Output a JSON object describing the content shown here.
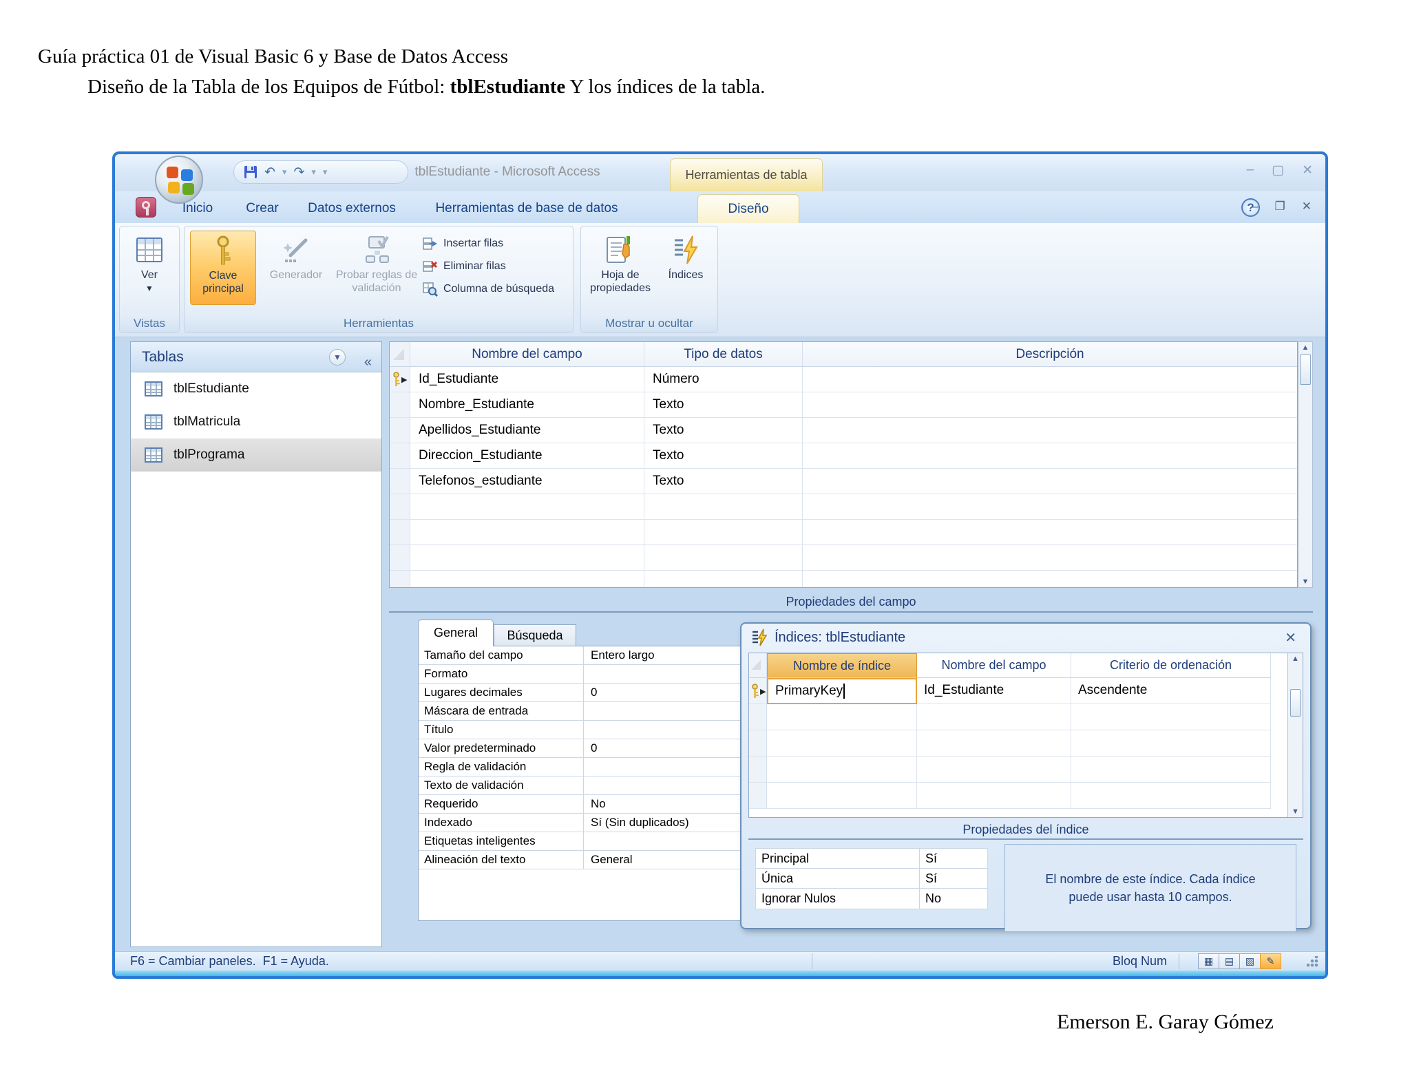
{
  "document": {
    "title": "Guía práctica 01 de Visual Basic 6 y Base de Datos Access",
    "subtitle_prefix": "Diseño de la Tabla de los Equipos de Fútbol: ",
    "subtitle_bold": "tblEstudiante",
    "subtitle_suffix": " Y los índices de la tabla.",
    "author": "Emerson E. Garay Gómez"
  },
  "window": {
    "title": "tblEstudiante - Microsoft Access",
    "contextual_tab_group": "Herramientas de tabla",
    "tabs": [
      "Inicio",
      "Crear",
      "Datos externos",
      "Herramientas de base de datos"
    ],
    "active_tab": "Diseño"
  },
  "ribbon": {
    "vistas": {
      "button": "Ver",
      "label": "Vistas"
    },
    "herramientas": {
      "label": "Herramientas",
      "clave": "Clave principal",
      "generador": "Generador",
      "probar": "Probar reglas de validación",
      "insertar": "Insertar filas",
      "eliminar": "Eliminar filas",
      "columna": "Columna de búsqueda"
    },
    "mostrar": {
      "label": "Mostrar u ocultar",
      "hoja": "Hoja de propiedades",
      "indices": "Índices"
    }
  },
  "nav_pane": {
    "header": "Tablas",
    "items": [
      {
        "label": "tblEstudiante",
        "selected": false
      },
      {
        "label": "tblMatricula",
        "selected": false
      },
      {
        "label": "tblPrograma",
        "selected": true
      }
    ]
  },
  "design_grid": {
    "columns": [
      "Nombre del campo",
      "Tipo de datos",
      "Descripción"
    ],
    "rows": [
      {
        "field": "Id_Estudiante",
        "type": "Número",
        "primary_key": true
      },
      {
        "field": "Nombre_Estudiante",
        "type": "Texto",
        "primary_key": false
      },
      {
        "field": "Apellidos_Estudiante",
        "type": "Texto",
        "primary_key": false
      },
      {
        "field": "Direccion_Estudiante",
        "type": "Texto",
        "primary_key": false
      },
      {
        "field": "Telefonos_estudiante",
        "type": "Texto",
        "primary_key": false
      }
    ],
    "footer_label": "Propiedades del campo"
  },
  "field_properties": {
    "tabs": [
      "General",
      "Búsqueda"
    ],
    "rows": [
      {
        "label": "Tamaño del campo",
        "value": "Entero largo"
      },
      {
        "label": "Formato",
        "value": ""
      },
      {
        "label": "Lugares decimales",
        "value": "0"
      },
      {
        "label": "Máscara de entrada",
        "value": ""
      },
      {
        "label": "Título",
        "value": ""
      },
      {
        "label": "Valor predeterminado",
        "value": "0"
      },
      {
        "label": "Regla de validación",
        "value": ""
      },
      {
        "label": "Texto de validación",
        "value": ""
      },
      {
        "label": "Requerido",
        "value": "No"
      },
      {
        "label": "Indexado",
        "value": "Sí (Sin duplicados)"
      },
      {
        "label": "Etiquetas inteligentes",
        "value": ""
      },
      {
        "label": "Alineación del texto",
        "value": "General"
      }
    ]
  },
  "indexes_dialog": {
    "title": "Índices: tblEstudiante",
    "columns": [
      "Nombre de índice",
      "Nombre del campo",
      "Criterio de ordenación"
    ],
    "rows": [
      {
        "index_name": "PrimaryKey",
        "field_name": "Id_Estudiante",
        "sort_order": "Ascendente"
      }
    ],
    "section_label": "Propiedades del índice",
    "properties": [
      {
        "label": "Principal",
        "value": "Sí"
      },
      {
        "label": "Única",
        "value": "Sí"
      },
      {
        "label": "Ignorar Nulos",
        "value": "No"
      }
    ],
    "help_text": "El nombre de este índice. Cada índice puede usar hasta 10 campos."
  },
  "status_bar": {
    "left": "F6 = Cambiar paneles.  F1 = Ayuda.",
    "num_lock": "Bloq Num"
  },
  "colors": {
    "window_border": "#2a7ad6",
    "ribbon_highlight_orange": "#fcae3e",
    "index_column_header_orange": "#efb756",
    "active_cell_border": "#e8a33d",
    "header_text_blue": "#1e3c78",
    "tab_text_blue": "#15428b",
    "active_tab_yellow": "#faf2cf",
    "help_box_bg": "#dde9f7",
    "bottom_glow_cyan": "#45b8e8"
  }
}
